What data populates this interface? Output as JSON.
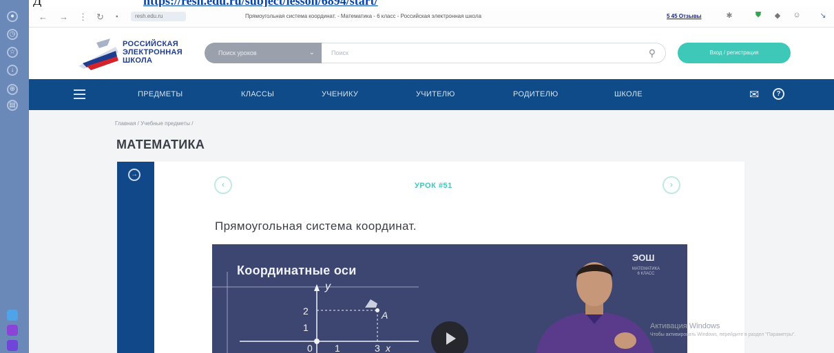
{
  "doc": {
    "prefix": "Д",
    "link": "https://resh.edu.ru/subject/lesson/6894/start/"
  },
  "browser": {
    "url": "resh.edu.ru",
    "tab_title": "Прямоугольная система координат. - Математика - 6 класс - Российская электронная школа",
    "ext_label": "5 45 Отзывы"
  },
  "site": {
    "logo_lines": [
      "РОССИЙСКАЯ",
      "ЭЛЕКТРОННАЯ",
      "ШКОЛА"
    ],
    "select_label": "Поиск уроков",
    "search_placeholder": "Поиск",
    "login_label": "Вход / регистрация"
  },
  "nav": {
    "items": [
      "ПРЕДМЕТЫ",
      "КЛАССЫ",
      "УЧЕНИКУ",
      "УЧИТЕЛЮ",
      "РОДИТЕЛЮ",
      "ШКОЛЕ"
    ]
  },
  "breadcrumb": "Главная / Учебные предметы /",
  "page_title": "МАТЕМАТИКА",
  "lesson": {
    "number": "УРОК #51",
    "title": "Прямоугольная система координат."
  },
  "video": {
    "title": "Координатные оси",
    "badge": "ЭОШ",
    "badge_sub": "МАТЕМАТИКА 6 КЛАСС",
    "axis_y": "y",
    "axis_x": "x",
    "tick_y2": "2",
    "tick_y1": "1",
    "origin": "0",
    "tick_x1": "1",
    "tick_x3": "3",
    "point": "A"
  },
  "watermark": {
    "title": "Активация Windows",
    "sub": "Чтобы активировать Windows, перейдите в раздел \"Параметры\"."
  },
  "colors": {
    "nav_bg": "#0f4a89",
    "accent": "#3ec8b8",
    "sidebar": "#6a88b8"
  }
}
